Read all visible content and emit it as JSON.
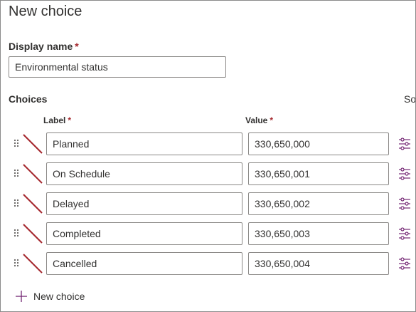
{
  "panel": {
    "title": "New choice"
  },
  "display_name": {
    "label": "Display name",
    "required_mark": "*",
    "value": "Environmental status"
  },
  "choices": {
    "heading": "Choices",
    "truncated_heading": "So",
    "column_label": "Label",
    "column_value": "Value",
    "required_mark": "*",
    "items": [
      {
        "label": "Planned",
        "value": "330,650,000"
      },
      {
        "label": "On Schedule",
        "value": "330,650,001"
      },
      {
        "label": "Delayed",
        "value": "330,650,002"
      },
      {
        "label": "Completed",
        "value": "330,650,003"
      },
      {
        "label": "Cancelled",
        "value": "330,650,004"
      }
    ],
    "add_label": "New choice"
  },
  "icons": {
    "drag": "drag-handle-icon",
    "color": "no-color-swatch-icon",
    "settings": "settings-sliders-icon",
    "add": "plus-icon"
  },
  "colors": {
    "accent": "#742774",
    "required": "#a4262c",
    "swatch_slash": "#a4262c",
    "border": "#8a8886",
    "text": "#323130"
  }
}
